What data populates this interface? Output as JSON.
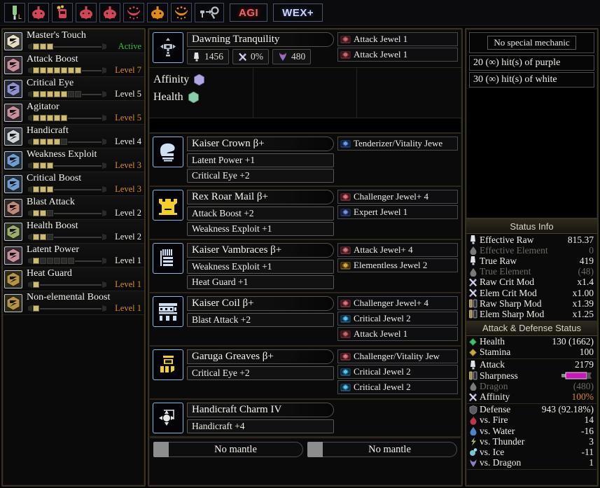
{
  "toolbar": {
    "icons": [
      {
        "name": "lance-weapon-icon",
        "kind": "weapon-lance"
      },
      {
        "name": "kulve-head-icon",
        "kind": "monster-red-1"
      },
      {
        "name": "kulve-item-icon",
        "kind": "monster-red-2"
      },
      {
        "name": "monster-red-head-icon",
        "kind": "monster-red-3"
      },
      {
        "name": "monster-red-head2-icon",
        "kind": "monster-red-4"
      },
      {
        "name": "monster-red-smile-icon",
        "kind": "monster-red-5"
      },
      {
        "name": "monster-orange-head-icon",
        "kind": "monster-orange-1"
      },
      {
        "name": "monster-orange-smile-icon",
        "kind": "monster-orange-2"
      },
      {
        "name": "weapon-swap-icon",
        "kind": "swap"
      }
    ],
    "badges": [
      {
        "label": "AGI",
        "color": "#e46b6b"
      },
      {
        "label": "WEX+",
        "color": "#cfd6f0"
      }
    ]
  },
  "skills": [
    {
      "name": "Master's Touch",
      "level_text": "Active",
      "level_style": "green",
      "filled": 3,
      "empty": 0,
      "icon_color": "#e6dfc3",
      "track": 0.6
    },
    {
      "name": "Attack Boost",
      "level_text": "Level 7",
      "level_style": "orange",
      "filled": 7,
      "empty": 0,
      "icon_color": "#c98f9c",
      "track": 0.04
    },
    {
      "name": "Critical Eye",
      "level_text": "Level 5",
      "level_style": "white",
      "filled": 5,
      "empty": 2,
      "icon_color": "#8e90cf",
      "track": 0.02
    },
    {
      "name": "Agitator",
      "level_text": "Level 5",
      "level_style": "orange",
      "filled": 5,
      "empty": 0,
      "icon_color": "#c98f9c",
      "track": 0.22
    },
    {
      "name": "Handicraft",
      "level_text": "Level 4",
      "level_style": "white",
      "filled": 4,
      "empty": 1,
      "icon_color": "#cfd7d9",
      "track": 0.24
    },
    {
      "name": "Weakness Exploit",
      "level_text": "Level 3",
      "level_style": "orange",
      "filled": 3,
      "empty": 0,
      "icon_color": "#6f9fd1",
      "track": 0.5
    },
    {
      "name": "Critical Boost",
      "level_text": "Level 3",
      "level_style": "orange",
      "filled": 3,
      "empty": 0,
      "icon_color": "#6f9fd1",
      "track": 0.5
    },
    {
      "name": "Blast Attack",
      "level_text": "Level 2",
      "level_style": "white",
      "filled": 2,
      "empty": 1,
      "icon_color": "#c08a7a",
      "track": 0.42
    },
    {
      "name": "Health Boost",
      "level_text": "Level 2",
      "level_style": "white",
      "filled": 2,
      "empty": 1,
      "icon_color": "#9bae6a",
      "track": 0.42
    },
    {
      "name": "Latent Power",
      "level_text": "Level 1",
      "level_style": "white",
      "filled": 1,
      "empty": 5,
      "icon_color": "#c98f9c",
      "track": 0.12
    },
    {
      "name": "Heat Guard",
      "level_text": "Level 1",
      "level_style": "orange",
      "filled": 1,
      "empty": 0,
      "icon_color": "#b5953f",
      "track": 0.72
    },
    {
      "name": "Non-elemental Boost",
      "level_text": "Level 1",
      "level_style": "orange",
      "filled": 1,
      "empty": 0,
      "icon_color": "#b5953f",
      "track": 0.72
    }
  ],
  "weapon": {
    "icon_name": "hammer-icon",
    "name": "Dawning Tranquility",
    "stats": [
      {
        "icon": "attack-icon",
        "value": "1456"
      },
      {
        "icon": "affinity-icon",
        "value": "0%"
      },
      {
        "icon": "dragon-element-icon",
        "value": "480"
      }
    ],
    "slots": [
      {
        "label": "Attack Jewel 1",
        "gem": "red-1"
      },
      {
        "label": "Attack Jewel 1",
        "gem": "red-1"
      }
    ]
  },
  "element_summary": {
    "lines": [
      {
        "label": "Affinity",
        "gem": "#b0a6e0"
      },
      {
        "label": "Health",
        "gem": "#88ceab"
      }
    ]
  },
  "armor": [
    {
      "icon_name": "helmet-icon",
      "icon_color": "#cfe0f2",
      "name": "Kaiser Crown β+",
      "skills": [
        "Latent Power +1",
        "Critical Eye +2"
      ],
      "slots": [
        {
          "label": "Tenderizer/Vitality Jewe",
          "gem": "blue-4"
        }
      ]
    },
    {
      "icon_name": "chest-icon",
      "icon_color": "#f2cf2a",
      "name": "Rex Roar Mail β+",
      "skills": [
        "Attack Boost +2",
        "Weakness Exploit +1"
      ],
      "slots": [
        {
          "label": "Challenger Jewel+ 4",
          "gem": "red-4"
        },
        {
          "label": "Expert Jewel 1",
          "gem": "blue-1"
        }
      ]
    },
    {
      "icon_name": "gauntlets-icon",
      "icon_color": "#cfe0f2",
      "name": "Kaiser Vambraces β+",
      "skills": [
        "Weakness Exploit +1",
        "Heat Guard +1"
      ],
      "slots": [
        {
          "label": "Attack Jewel+ 4",
          "gem": "red-4"
        },
        {
          "label": "Elementless Jewel 2",
          "gem": "gold-2"
        }
      ]
    },
    {
      "icon_name": "waist-icon",
      "icon_color": "#cfe0f2",
      "name": "Kaiser Coil β+",
      "skills": [
        "Blast Attack +2"
      ],
      "slots": [
        {
          "label": "Challenger Jewel+ 4",
          "gem": "red-4"
        },
        {
          "label": "Critical Jewel 2",
          "gem": "cyan-2"
        },
        {
          "label": "Attack Jewel 1",
          "gem": "red-1"
        }
      ]
    },
    {
      "icon_name": "boots-icon",
      "icon_color": "#f2cf2a",
      "name": "Garuga Greaves β+",
      "skills": [
        "Critical Eye +2"
      ],
      "slots": [
        {
          "label": "Challenger/Vitality Jew",
          "gem": "red-4"
        },
        {
          "label": "Critical Jewel 2",
          "gem": "cyan-2"
        },
        {
          "label": "Critical Jewel 2",
          "gem": "cyan-2"
        }
      ]
    },
    {
      "icon_name": "charm-icon",
      "icon_color": "#e8e8e8",
      "name": "Handicraft Charm IV",
      "skills": [
        "Handicraft +4"
      ],
      "slots": []
    }
  ],
  "mantles": [
    {
      "label": "No mantle"
    },
    {
      "label": "No mantle"
    }
  ],
  "mechanic": {
    "header": "No special mechanic",
    "lines": [
      "20 (∞) hit(s) of purple",
      "30 (∞) hit(s) of white"
    ]
  },
  "status": {
    "title": "Status Info",
    "groups": [
      {
        "rows": [
          {
            "icon": "attack-icon",
            "label": "Effective Raw",
            "value": "815.37",
            "dim": false
          },
          {
            "icon": "element-icon",
            "label": "Effective Element",
            "value": "0",
            "dim": true
          },
          {
            "icon": "attack-icon",
            "label": "True Raw",
            "value": "419",
            "dim": false
          },
          {
            "icon": "element-icon",
            "label": "True Element",
            "value": "(48)",
            "dim": true
          },
          {
            "icon": "affinity-icon",
            "label": "Raw Crit Mod",
            "value": "x1.4",
            "dim": false
          },
          {
            "icon": "affinity-icon",
            "label": "Elem Crit Mod",
            "value": "x1.00",
            "dim": false
          },
          {
            "icon": "sharpness-icon",
            "label": "Raw Sharp Mod",
            "value": "x1.39",
            "dim": false
          },
          {
            "icon": "sharpness-icon",
            "label": "Elem Sharp Mod",
            "value": "x1.25",
            "dim": false
          }
        ]
      }
    ],
    "subtitle": "Attack & Defense Status",
    "vitals": [
      {
        "icon": "health-gem-icon",
        "label": "Health",
        "value": "130 (1662)",
        "dim": false
      },
      {
        "icon": "stamina-gem-icon",
        "label": "Stamina",
        "value": "100",
        "dim": false
      }
    ],
    "offense": [
      {
        "icon": "attack-icon",
        "label": "Attack",
        "value": "2179",
        "dim": false,
        "style": ""
      },
      {
        "icon": "sharpness-icon",
        "label": "Sharpness",
        "value": "",
        "dim": false,
        "style": "sharpbar",
        "sharpness_color": "#c718b8"
      },
      {
        "icon": "element-icon",
        "label": "Dragon",
        "value": "(480)",
        "dim": true,
        "style": ""
      },
      {
        "icon": "affinity-icon",
        "label": "Affinity",
        "value": "100%",
        "dim": false,
        "style": "orange"
      }
    ],
    "defense": [
      {
        "icon": "defense-icon",
        "label": "Defense",
        "value": "943 (92.18%)",
        "dim": false
      },
      {
        "icon": "fire-icon",
        "label": "vs. Fire",
        "value": "14",
        "dim": false
      },
      {
        "icon": "water-icon",
        "label": "vs. Water",
        "value": "-16",
        "dim": false
      },
      {
        "icon": "thunder-icon",
        "label": "vs. Thunder",
        "value": "3",
        "dim": false
      },
      {
        "icon": "ice-icon",
        "label": "vs. Ice",
        "value": "-11",
        "dim": false
      },
      {
        "icon": "dragon-icon",
        "label": "vs. Dragon",
        "value": "1",
        "dim": false
      }
    ]
  }
}
